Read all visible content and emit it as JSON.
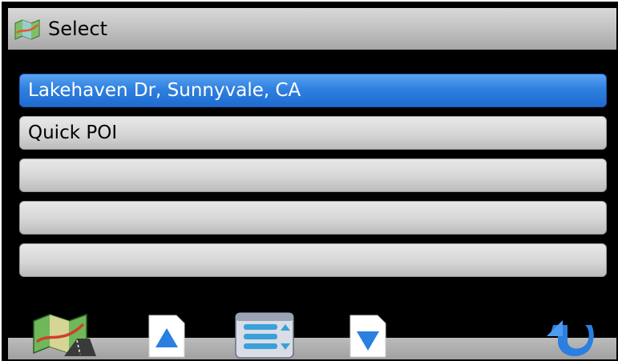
{
  "header": {
    "title": "Select",
    "icon": "map-icon"
  },
  "list": {
    "items": [
      {
        "label": "Lakehaven Dr, Sunnyvale, CA",
        "selected": true
      },
      {
        "label": "Quick POI",
        "selected": false
      },
      {
        "label": "",
        "selected": false
      },
      {
        "label": "",
        "selected": false
      },
      {
        "label": "",
        "selected": false
      }
    ]
  },
  "toolbar": {
    "buttons": [
      {
        "name": "map-button",
        "icon": "map-route-icon"
      },
      {
        "name": "scroll-up-button",
        "icon": "arrow-up-icon"
      },
      {
        "name": "list-view-button",
        "icon": "list-icon"
      },
      {
        "name": "scroll-down-button",
        "icon": "arrow-down-icon"
      },
      {
        "name": "back-button",
        "icon": "return-arrow-icon"
      }
    ]
  },
  "colors": {
    "selected": "#2f80e0",
    "row": "#d6d6d6",
    "background": "#000000"
  }
}
